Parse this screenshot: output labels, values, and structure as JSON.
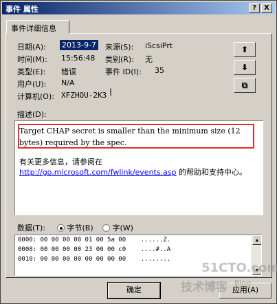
{
  "window": {
    "title": "事件 属性",
    "help_glyph": "?",
    "close_glyph": "X"
  },
  "tab": {
    "label": "事件详细信息"
  },
  "fields": {
    "date_label": "日期(A):",
    "date_value": "2013-9-7",
    "time_label": "时间(M):",
    "time_value": "15:56:48",
    "type_label": "类型(E):",
    "type_value": "错误",
    "user_label": "用户(U):",
    "user_value": "N/A",
    "computer_label": "计算机(O):",
    "computer_value": "XFZHOU-2K3",
    "source_label": "来源(S):",
    "source_value": "iScsiPrt",
    "category_label": "类别(R):",
    "category_value": "无",
    "event_id_label": "事件 ID(I):",
    "event_id_value": "35"
  },
  "nav": {
    "up_glyph": "⬆",
    "down_glyph": "⬇",
    "copy_glyph": "⧉"
  },
  "description": {
    "label": "描述(D):",
    "text": "Target CHAP secret is smaller than the minimum size (12 bytes) required by the spec.",
    "more_prefix": "有关更多信息，请参阅在",
    "link": "http://go.microsoft.com/fwlink/events.asp",
    "more_suffix": " 的帮助和支持中心。"
  },
  "data": {
    "label": "数据(T):",
    "bytes_option": "字节(B)",
    "words_option": "字(W)",
    "rows": [
      "0000: 00 00 00 00 01 00 5a 00    ......Z.",
      "0008: 00 00 00 00 23 00 00 c0    ....#..A",
      "0010: 00 00 00 00 00 00 00 00    ........"
    ]
  },
  "buttons": {
    "ok": "确定",
    "apply": "应用(A)"
  },
  "watermark": {
    "line1": "51CTO.com",
    "line2": "技术博客",
    "line3": "Blog"
  }
}
